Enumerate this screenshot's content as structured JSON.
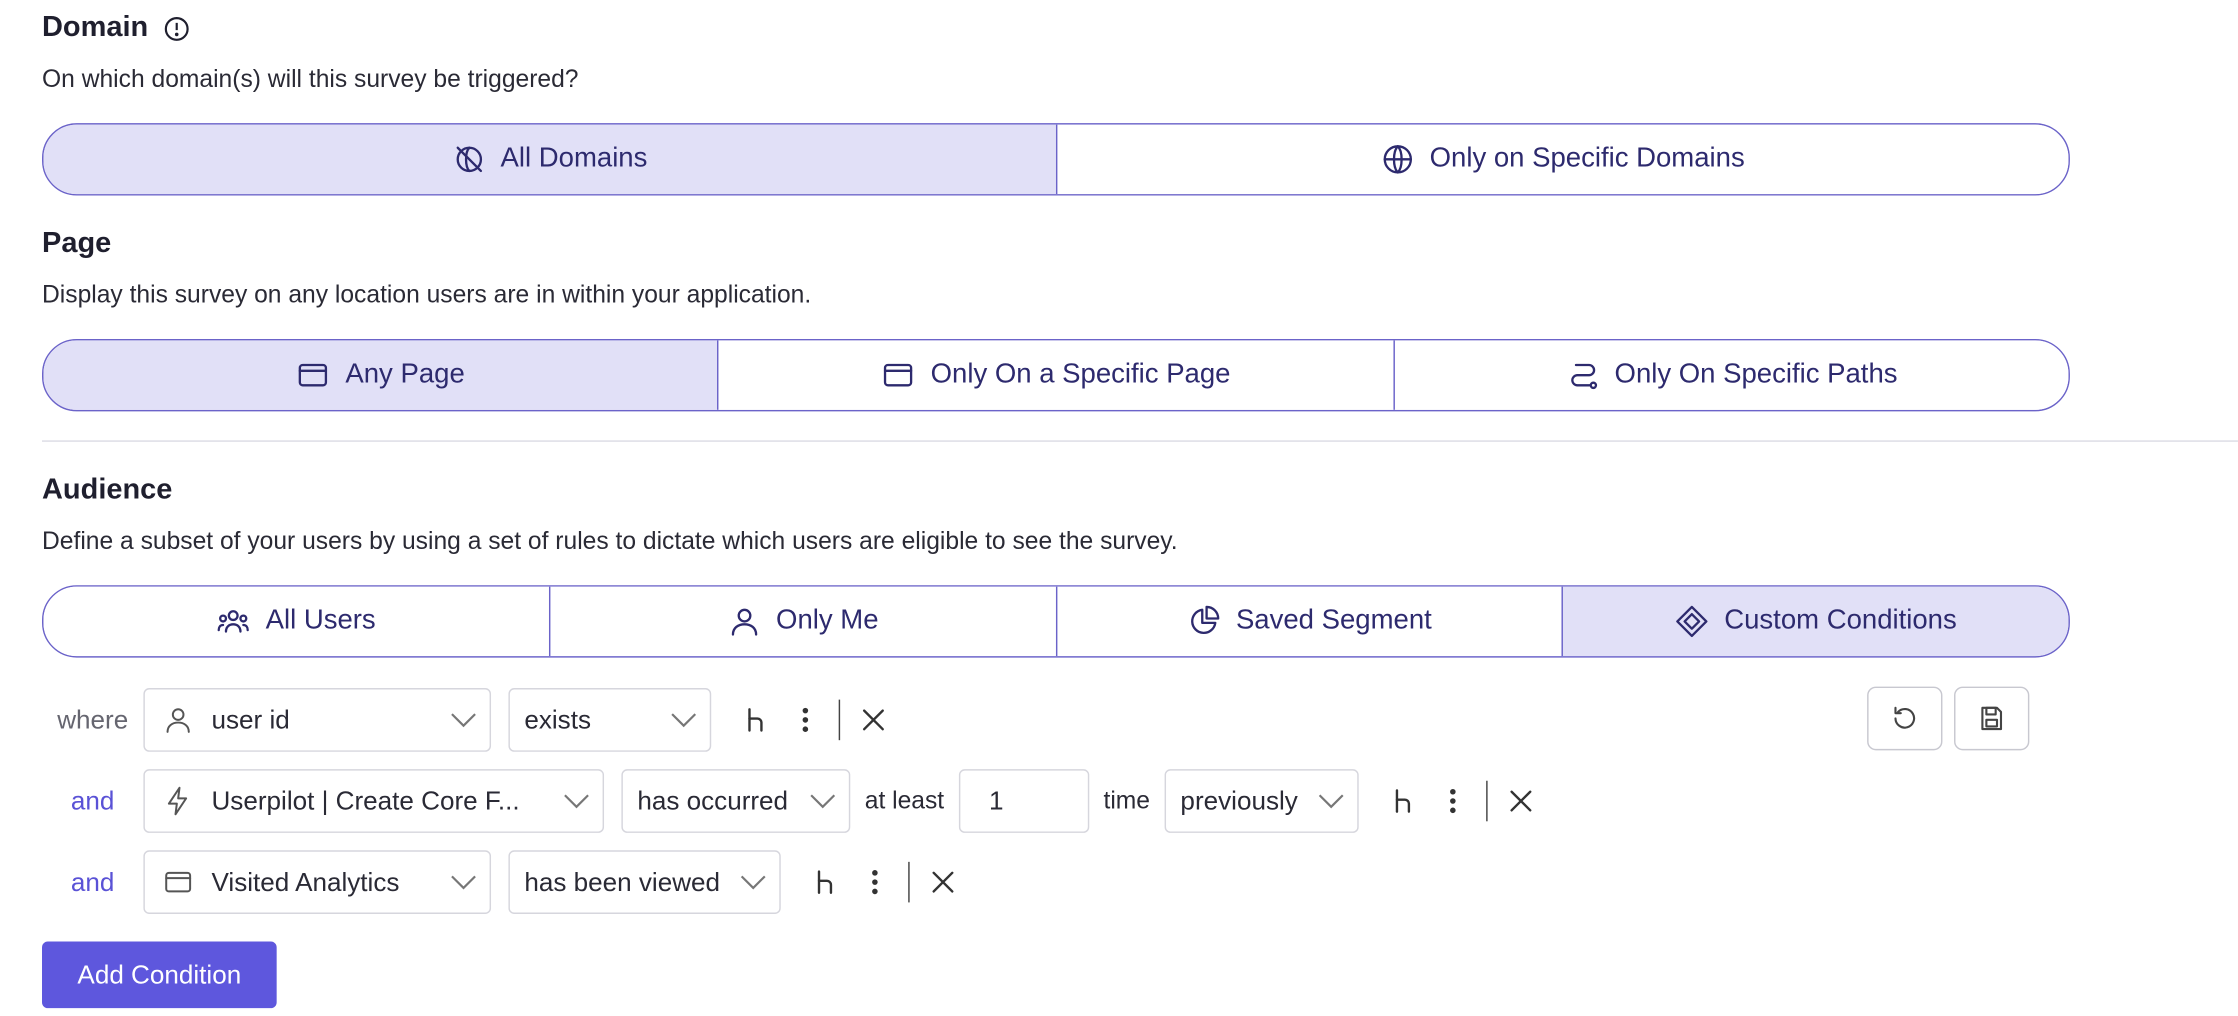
{
  "domain": {
    "title": "Domain",
    "description": "On which domain(s) will this survey be triggered?",
    "options": [
      {
        "label": "All Domains",
        "active": true
      },
      {
        "label": "Only on Specific Domains",
        "active": false
      }
    ]
  },
  "page": {
    "title": "Page",
    "description": "Display this survey on any location users are in within your application.",
    "options": [
      {
        "label": "Any Page",
        "active": true
      },
      {
        "label": "Only On a Specific Page",
        "active": false
      },
      {
        "label": "Only On Specific Paths",
        "active": false
      }
    ]
  },
  "audience": {
    "title": "Audience",
    "description": "Define a subset of your users by using a set of rules to dictate which users are eligible to see the survey.",
    "options": [
      {
        "label": "All Users",
        "active": false
      },
      {
        "label": "Only Me",
        "active": false
      },
      {
        "label": "Saved Segment",
        "active": false
      },
      {
        "label": "Custom Conditions",
        "active": true
      }
    ]
  },
  "conditions": [
    {
      "connector": "where",
      "field": "user id",
      "operator": "exists"
    },
    {
      "connector": "and",
      "field": "Userpilot | Create Core F...",
      "operator": "has occurred",
      "at_least_label": "at least",
      "count": "1",
      "time_label": "time",
      "timeframe": "previously"
    },
    {
      "connector": "and",
      "field": "Visited Analytics",
      "operator": "has been viewed"
    }
  ],
  "add_condition_label": "Add Condition",
  "colors": {
    "accent": "#5e57dd",
    "active_segment": "#e1e0f7",
    "segment_border": "#6b63c9",
    "connector_and": "#5a52d6"
  }
}
